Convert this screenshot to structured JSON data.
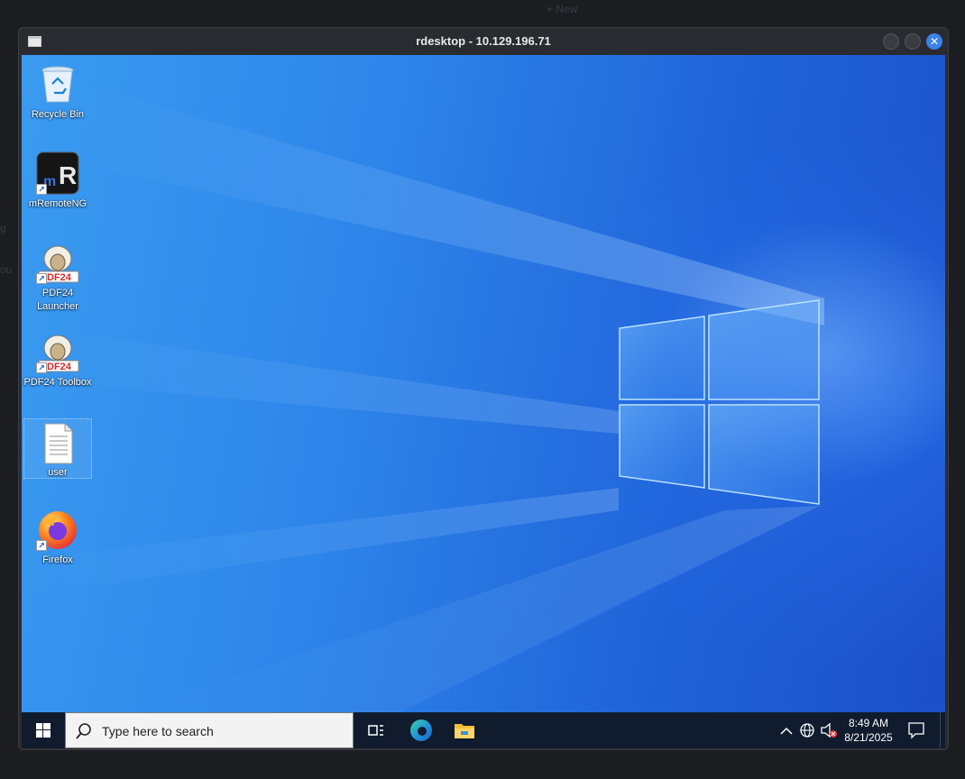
{
  "background": {
    "new_button_label": "+ New",
    "text_g": "g",
    "text_o": "ou"
  },
  "window": {
    "title": "rdesktop - 10.129.196.71"
  },
  "desktop": {
    "icons": [
      {
        "label": "Recycle Bin",
        "icon": "recycle-bin-icon"
      },
      {
        "label": "mRemoteNG",
        "icon": "mremoteng-icon"
      },
      {
        "label": "PDF24 Launcher",
        "icon": "pdf24-launcher-icon"
      },
      {
        "label": "PDF24 Toolbox",
        "icon": "pdf24-toolbox-icon"
      },
      {
        "label": "user",
        "icon": "text-file-icon"
      },
      {
        "label": "Firefox",
        "icon": "firefox-icon"
      }
    ]
  },
  "taskbar": {
    "search_placeholder": "Type here to search",
    "apps": [
      "task-view-icon",
      "edge-icon",
      "file-explorer-icon"
    ],
    "tray": {
      "icons": [
        "chevron-up-icon",
        "network-icon",
        "volume-muted-icon"
      ],
      "time": "8:49 AM",
      "date": "8/21/2025"
    }
  },
  "colors": {
    "accent": "#3b82e7",
    "taskbar": "#101c2e",
    "desktop_blue": "#2e86ea"
  }
}
